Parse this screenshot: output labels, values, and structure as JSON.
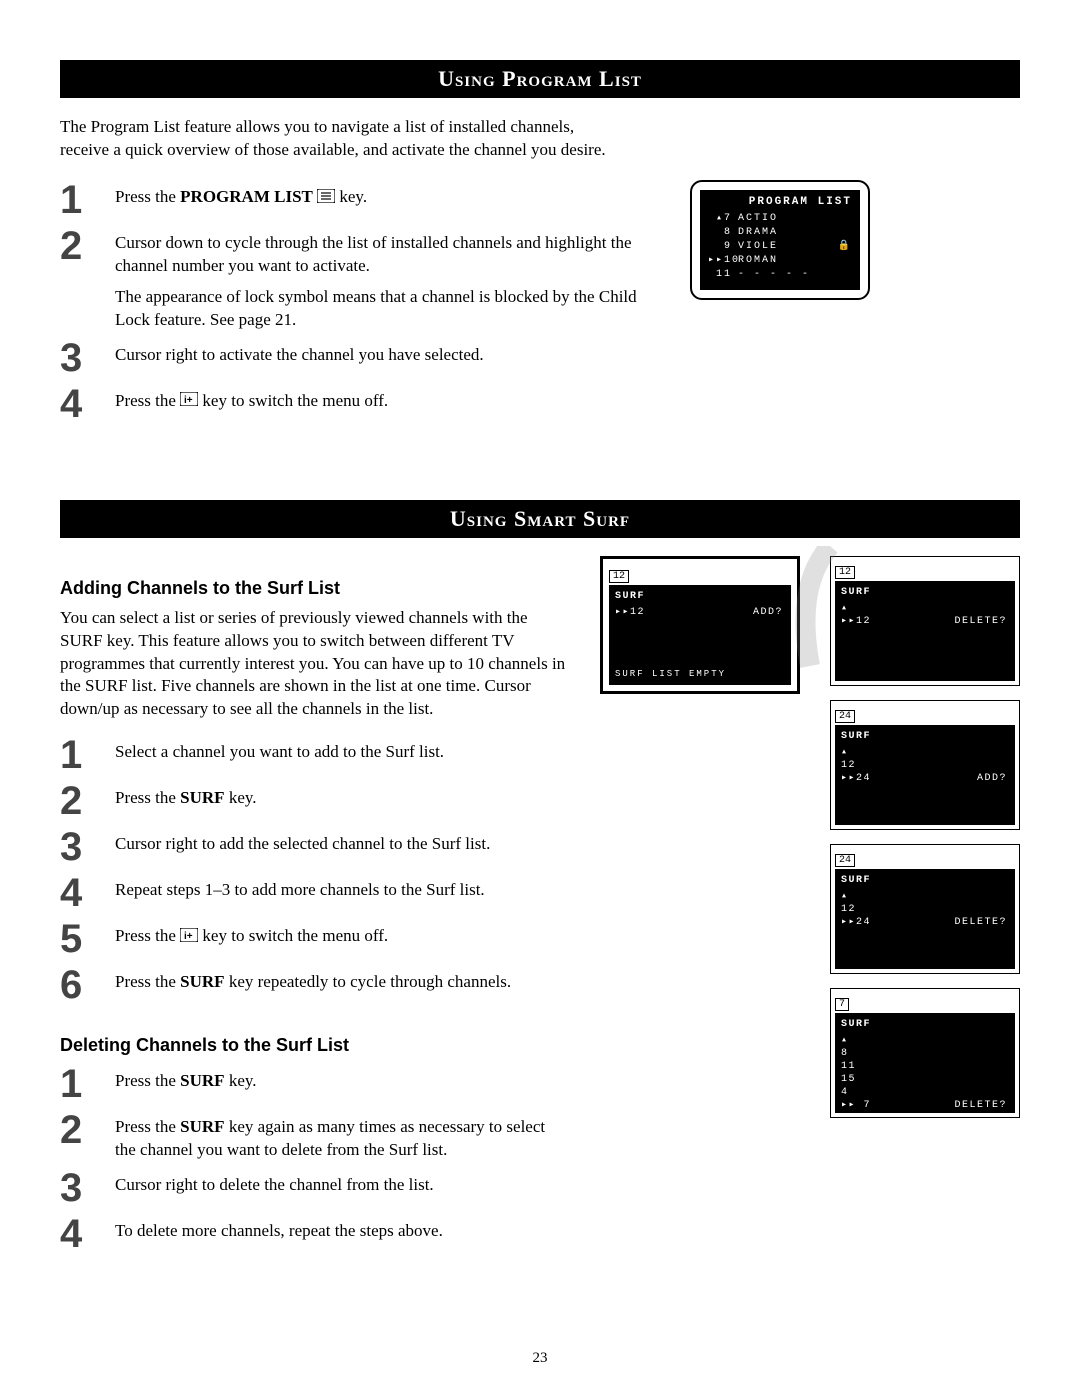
{
  "page_number": "23",
  "section1": {
    "header": "Using Program List",
    "intro": "The Program List feature allows you to navigate a list of installed channels, receive a quick overview of those available, and activate the channel you desire.",
    "steps": [
      {
        "num": "1",
        "html": "Press the <b>PROGRAM LIST</b> <span class='icon-inline' data-name='menu-icon' data-interactable='false'><svg width='18' height='14' viewBox='0 0 18 14'><rect x='0' y='0' width='18' height='14' rx='2' fill='none' stroke='#000' stroke-width='1.2'/><line x1='4' y1='4' x2='14' y2='4' stroke='#000' stroke-width='1.2'/><line x1='4' y1='7' x2='14' y2='7' stroke='#000' stroke-width='1.2'/><line x1='4' y1='10' x2='14' y2='10' stroke='#000' stroke-width='1.2'/></svg></span> key."
      },
      {
        "num": "2",
        "html": "Cursor down to cycle through the list of installed channels and highlight the channel number you want to activate.<div class='extra'>The appearance of lock symbol means that a channel is blocked by the Child Lock feature. See page 21.</div>"
      },
      {
        "num": "3",
        "html": "Cursor right to activate the channel you have selected."
      },
      {
        "num": "4",
        "html": "Press the <span class='icon-inline' data-name='info-icon' data-interactable='false'><svg width='18' height='14' viewBox='0 0 18 14'><rect x='0' y='0' width='18' height='14' rx='2' fill='none' stroke='#000' stroke-width='1.2'/><text x='4' y='11' font-size='10' font-family='Arial' font-weight='bold'>i+</text></svg></span> key to switch the menu off."
      }
    ],
    "tv": {
      "title": "PROGRAM LIST",
      "rows": [
        {
          "mark": "▴",
          "num": "7",
          "name": "ACTIO",
          "lock": ""
        },
        {
          "mark": "",
          "num": "8",
          "name": "DRAMA",
          "lock": ""
        },
        {
          "mark": "",
          "num": "9",
          "name": "VIOLE",
          "lock": "🔒"
        },
        {
          "mark": "▸▸",
          "num": "10",
          "name": "ROMAN",
          "lock": ""
        },
        {
          "mark": "",
          "num": "11",
          "name": "- - - - -",
          "lock": ""
        }
      ]
    }
  },
  "section2": {
    "header": "Using Smart Surf",
    "sub1": "Adding Channels to the Surf List",
    "body1": "You can select a list or series of previously viewed channels with the SURF key. This feature allows you to switch between different TV programmes that currently interest you. You can have up to 10 channels in the SURF list. Five channels are shown in the list at one time. Cursor down/up as necessary to see all the channels in the list.",
    "add_steps": [
      {
        "num": "1",
        "html": "Select a channel you want to add to the Surf list."
      },
      {
        "num": "2",
        "html": "Press the <b>SURF</b> key."
      },
      {
        "num": "3",
        "html": "Cursor right to add the selected channel to the Surf list."
      },
      {
        "num": "4",
        "html": "Repeat steps 1–3 to add more channels to the Surf list."
      },
      {
        "num": "5",
        "html": "Press the <span class='icon-inline' data-name='info-icon' data-interactable='false'><svg width='18' height='14' viewBox='0 0 18 14'><rect x='0' y='0' width='18' height='14' rx='2' fill='none' stroke='#000' stroke-width='1.2'/><text x='4' y='11' font-size='10' font-family='Arial' font-weight='bold'>i+</text></svg></span> key to switch the menu off."
      },
      {
        "num": "6",
        "html": "Press the <b>SURF</b> key repeatedly to cycle through channels."
      }
    ],
    "sub2": "Deleting Channels to the Surf List",
    "del_steps": [
      {
        "num": "1",
        "html": "Press the <b>SURF</b> key."
      },
      {
        "num": "2",
        "html": "Press the <b>SURF</b> key again as many times as necessary to select the channel you want to delete from the Surf list."
      },
      {
        "num": "3",
        "html": "Cursor right to delete the channel from the list."
      },
      {
        "num": "4",
        "html": "To delete more channels, repeat the steps above."
      }
    ],
    "surfboxes": {
      "big": {
        "chan": "12",
        "title": "SURF",
        "line": "▸▸12",
        "action": "ADD?",
        "footer": "SURF LIST EMPTY"
      },
      "s1": {
        "chan": "12",
        "title": "SURF",
        "lines": [
          "▴",
          "▸▸12"
        ],
        "action": "DELETE?",
        "action_row": 1
      },
      "s2": {
        "chan": "24",
        "title": "SURF",
        "lines": [
          "▴",
          "  12",
          "▸▸24"
        ],
        "action": "ADD?",
        "action_row": 2
      },
      "s3": {
        "chan": "24",
        "title": "SURF",
        "lines": [
          "▴",
          "  12",
          "▸▸24"
        ],
        "action": "DELETE?",
        "action_row": 2
      },
      "s4": {
        "chan": "7",
        "title": "SURF",
        "lines": [
          "▴",
          "   8",
          "  11",
          "  15",
          "   4",
          "▸▸ 7"
        ],
        "action": "DELETE?",
        "action_row": 5
      }
    }
  }
}
